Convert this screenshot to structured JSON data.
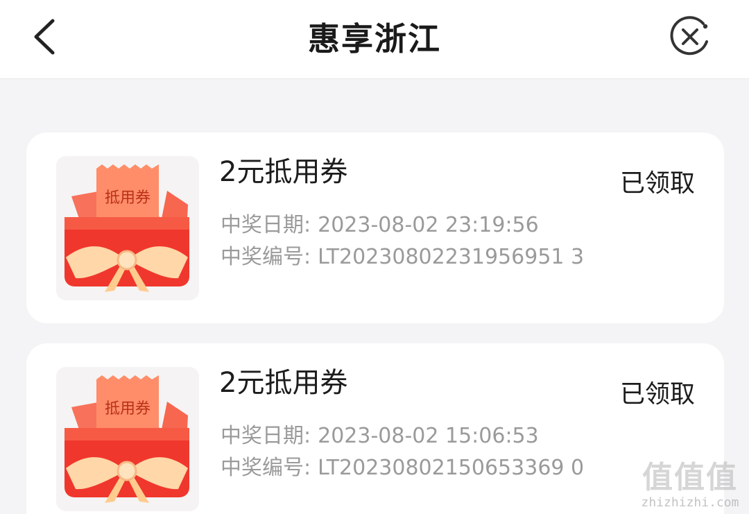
{
  "header": {
    "title": "惠享浙江",
    "back_icon": "chevron-left-icon",
    "close_icon": "close-circle-icon"
  },
  "records": [
    {
      "thumb_label": "抵用券",
      "title": "2元抵用券",
      "status": "已领取",
      "date_label": "中奖日期:",
      "date_value": "2023-08-02 23:19:56",
      "id_label": "中奖编号:",
      "id_value": "LT20230802231956951 3"
    },
    {
      "thumb_label": "抵用券",
      "title": "2元抵用券",
      "status": "已领取",
      "date_label": "中奖日期:",
      "date_value": "2023-08-02 15:06:53",
      "id_label": "中奖编号:",
      "id_value": "LT20230802150653369 0"
    }
  ],
  "watermark": {
    "main": "值值值",
    "sub": "zhizhizhi.com"
  },
  "colors": {
    "background": "#f4f4f6",
    "card": "#ffffff",
    "envelope_red": "#f24a3c",
    "ticket_orange": "#ff8a63",
    "ribbon": "#ffd9a8"
  }
}
